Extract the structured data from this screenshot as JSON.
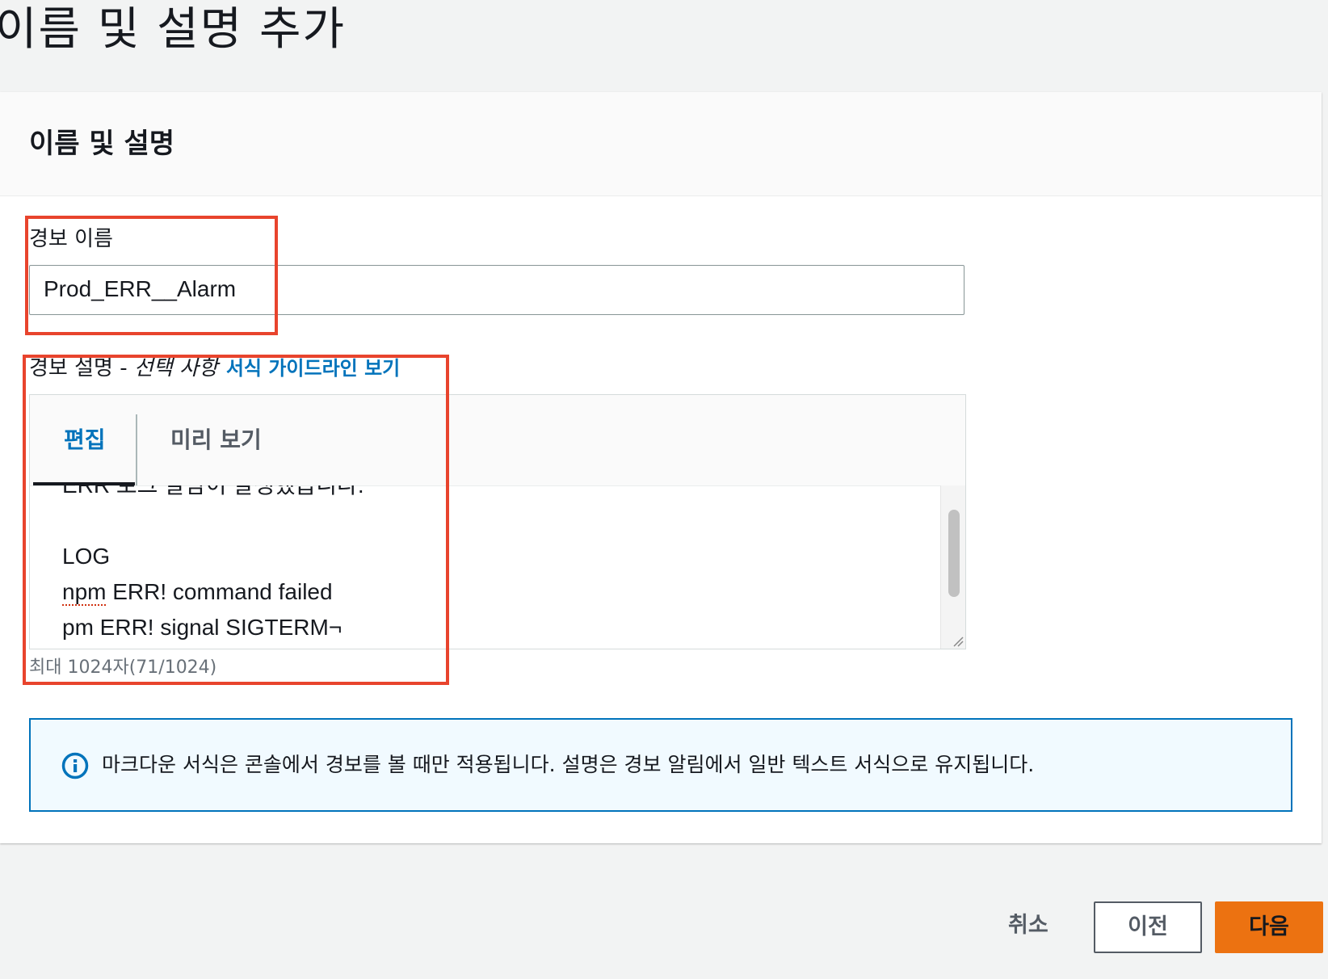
{
  "page": {
    "title": "이름 및 설명 추가"
  },
  "panel": {
    "title": "이름 및 설명"
  },
  "alarm_name": {
    "label": "경보 이름",
    "value": "Prod_ERR__Alarm"
  },
  "alarm_description": {
    "label": "경보 설명 - ",
    "optional_label": "선택 사항",
    "format_link": "서식 가이드라인 보기",
    "tabs": {
      "edit": "편집",
      "preview": "미리 보기",
      "active": "편집"
    },
    "lines": {
      "l1": "ERR 로그 알람이 발생했습니다.",
      "l2": "",
      "l3": "LOG",
      "l4_word": "npm",
      "l4_rest": " ERR! command failed",
      "l5": "pm ERR! signal SIGTERM",
      "l5_suffix": "¬"
    },
    "char_count": "최대 1024자(71/1024)"
  },
  "info": {
    "icon": "info-icon",
    "text": "마크다운 서식은 콘솔에서 경보를 볼 때만 적용됩니다. 설명은 경보 알림에서 일반 텍스트 서식으로 유지됩니다."
  },
  "footer": {
    "cancel": "취소",
    "previous": "이전",
    "next": "다음"
  },
  "colors": {
    "primary_button": "#ec7211",
    "link": "#0073bb",
    "annotation": "#e8442d",
    "info_border": "#0073bb",
    "info_bg": "#f1faff"
  }
}
